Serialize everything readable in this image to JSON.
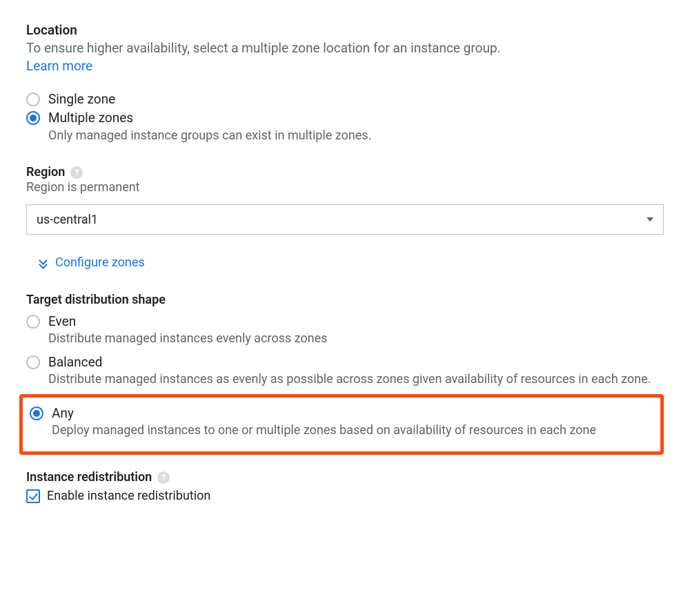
{
  "location": {
    "title": "Location",
    "desc": "To ensure higher availability, select a multiple zone location for an instance group.",
    "learn_more": "Learn more",
    "options": {
      "single": {
        "label": "Single zone"
      },
      "multiple": {
        "label": "Multiple zones",
        "sublabel": "Only managed instance groups can exist in multiple zones."
      }
    }
  },
  "region": {
    "title": "Region",
    "desc": "Region is permanent",
    "value": "us-central1",
    "configure_zones": "Configure zones"
  },
  "tds": {
    "title": "Target distribution shape",
    "even": {
      "label": "Even",
      "sublabel": "Distribute managed instances evenly across zones"
    },
    "balanced": {
      "label": "Balanced",
      "sublabel": "Distribute managed instances as evenly as possible across zones given availability of resources in each zone."
    },
    "any": {
      "label": "Any",
      "sublabel": "Deploy managed instances to one or multiple zones based on availability of resources in each zone"
    }
  },
  "redistribution": {
    "title": "Instance redistribution",
    "checkbox_label": "Enable instance redistribution"
  },
  "help_glyph": "?"
}
